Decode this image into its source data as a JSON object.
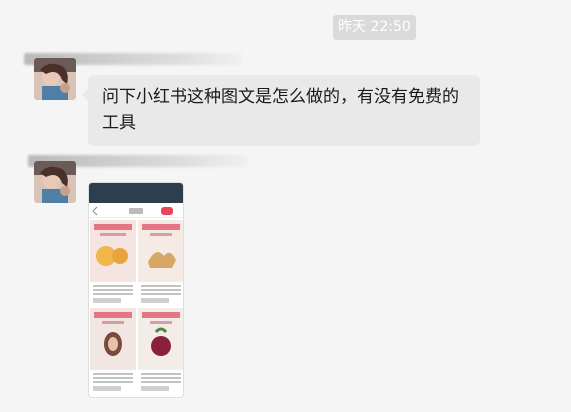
{
  "timestamp": "昨天 22:50",
  "messages": [
    {
      "type": "text",
      "text": "问下小红书这种图文是怎么做的，有没有免费的工具"
    },
    {
      "type": "image",
      "description_icon": "screenshot-thumbnail-icon"
    }
  ]
}
